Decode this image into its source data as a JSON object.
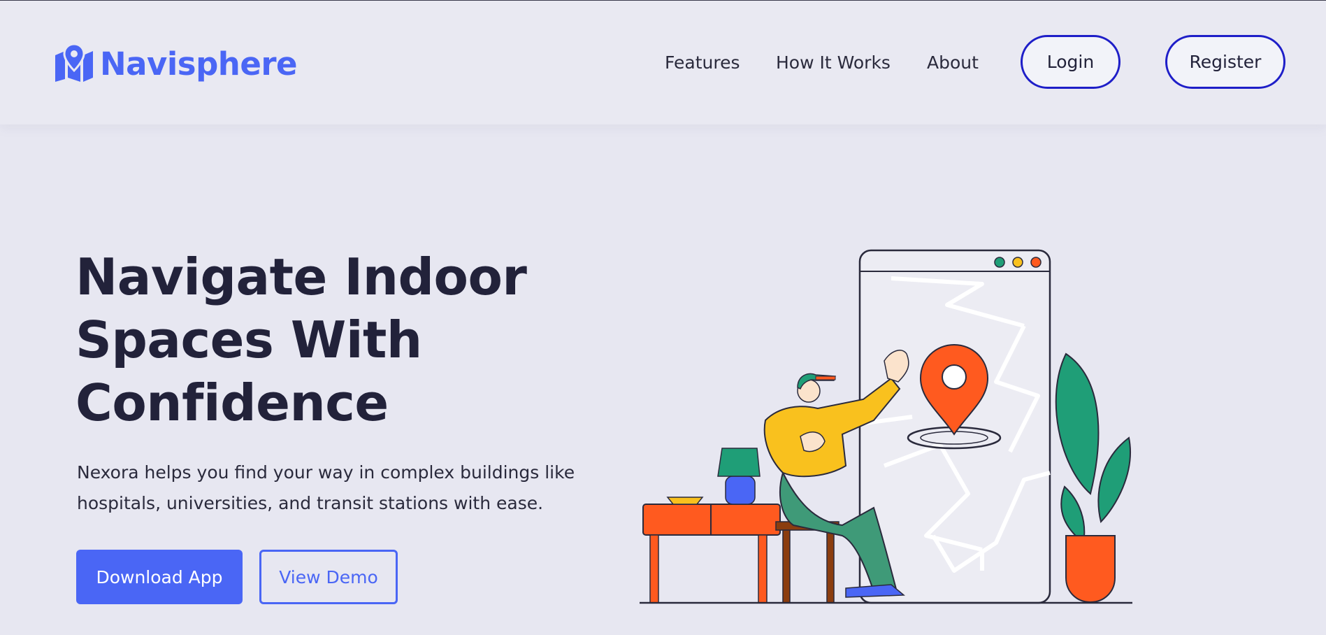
{
  "brand": {
    "name": "Navisphere",
    "logo_icon": "map-pin-icon",
    "accent": "#4a66f5"
  },
  "nav": {
    "links": [
      "Features",
      "How It Works",
      "About"
    ],
    "login_label": "Login",
    "register_label": "Register"
  },
  "hero": {
    "title_line1": "Navigate Indoor",
    "title_line2": "Spaces With",
    "title_line3": "Confidence",
    "subtitle_line1": "Nexora helps you find your way in complex buildings like",
    "subtitle_line2": "hospitals, universities, and transit stations with ease.",
    "primary_cta": "Download App",
    "secondary_cta": "View Demo"
  },
  "colors": {
    "background": "#e7e7f1",
    "primary": "#4a66f5",
    "pill_border": "#1e1ec8",
    "orange": "#ff5a1f",
    "green": "#1f9e77",
    "yellow": "#f9c11e"
  }
}
